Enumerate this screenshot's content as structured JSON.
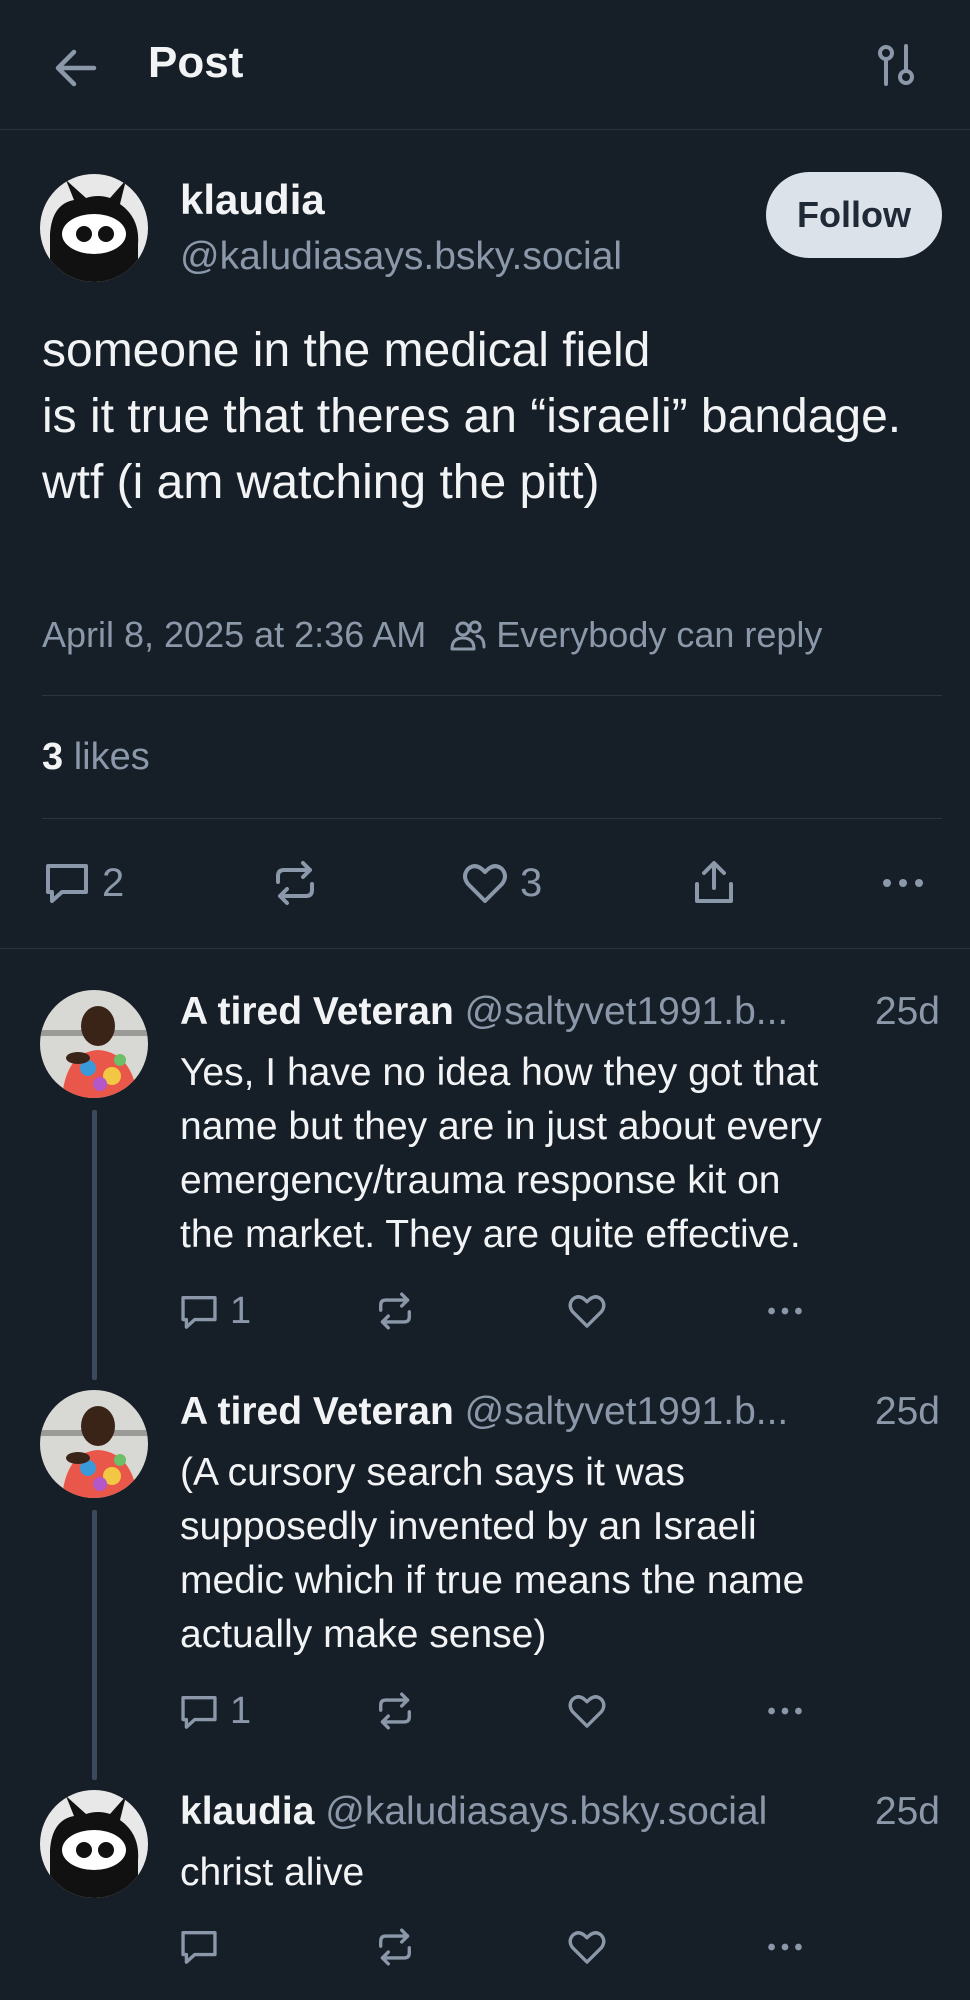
{
  "header": {
    "title": "Post",
    "back_icon": "arrow-left-icon",
    "settings_icon": "sliders-icon"
  },
  "main_post": {
    "author_name": "klaudia",
    "author_handle": "@kaludiasays.bsky.social",
    "follow_label": "Follow",
    "text": "someone in the medical field\nis it true that theres an “israeli” bandage. wtf (i am watching the pitt)",
    "timestamp": "April 8, 2025 at 2:36 AM",
    "reply_setting": "Everybody can reply",
    "likes_count": "3",
    "likes_label": "likes",
    "reply_count": "2",
    "like_count": "3"
  },
  "replies": [
    {
      "author_name": "A tired Veteran",
      "author_handle": "@saltyvet1991.b...",
      "time": "25d",
      "text": "Yes, I have no idea how they got that\nname but they are in just about every\nemergency/trauma response kit on\nthe market. They are quite effective.",
      "reply_count": "1"
    },
    {
      "author_name": "A tired Veteran",
      "author_handle": "@saltyvet1991.b...",
      "time": "25d",
      "text": "(A cursory search says it was\nsupposedly invented by an Israeli\nmedic which if true means the name\nactually make sense)",
      "reply_count": "1"
    },
    {
      "author_name": "klaudia",
      "author_handle": "@kaludiasays.bsky.social",
      "time": "25d",
      "text": "christ alive",
      "reply_count": ""
    }
  ],
  "colors": {
    "background": "#161e27",
    "muted": "#8b98a9",
    "divider": "#2a3441",
    "follow_bg": "#dce2ea"
  }
}
